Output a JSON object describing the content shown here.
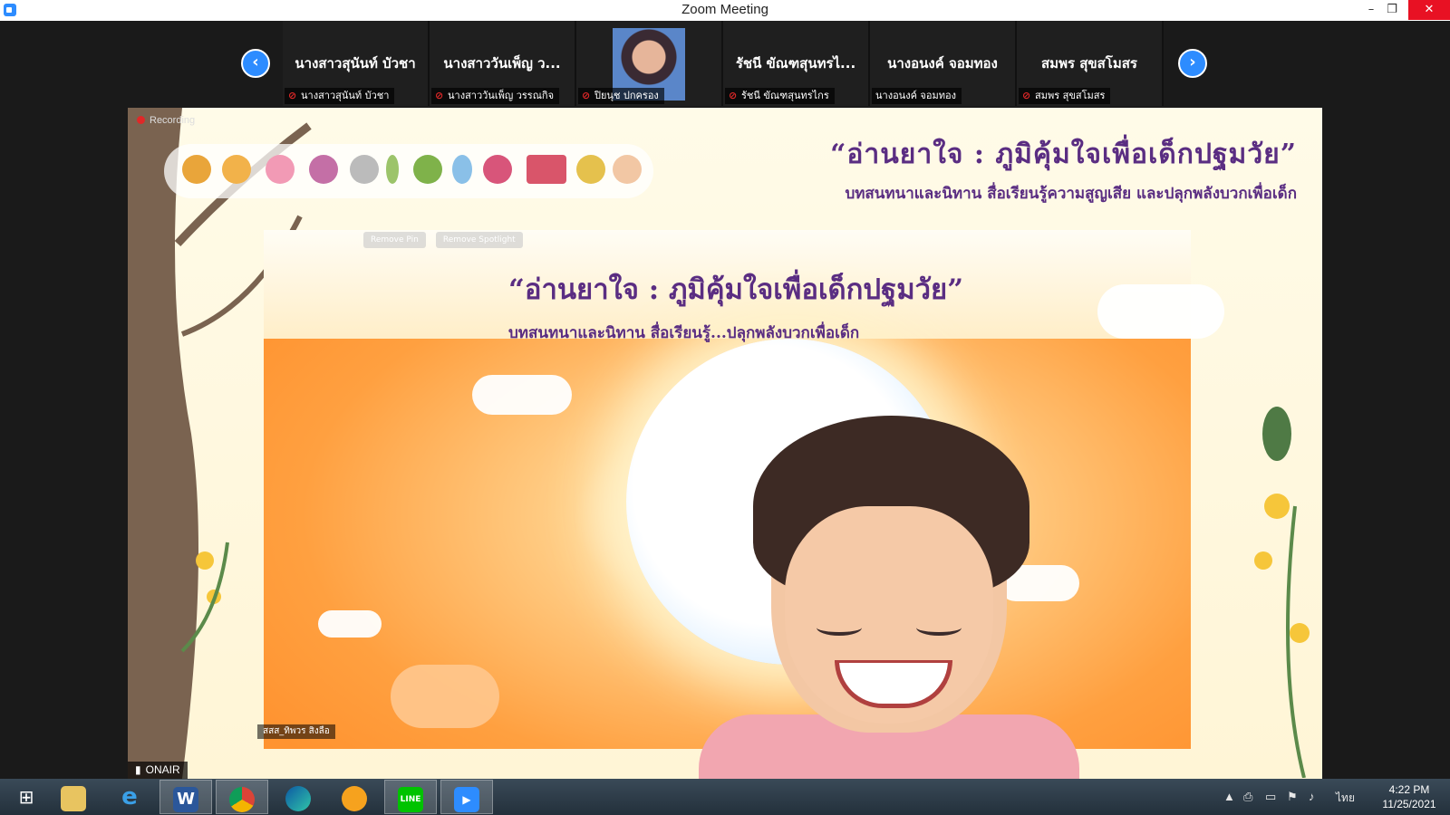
{
  "window": {
    "title": "Zoom Meeting",
    "minimize_label": "–",
    "maximize_label": "❐",
    "close_label": "✕"
  },
  "participants": {
    "prev_label": "‹",
    "next_label": "›",
    "tiles": [
      {
        "display_name": "นางสาวสุนันท์ บัวชา",
        "label": "นางสาวสุนันท์ บัวชา",
        "muted": true,
        "has_video": false
      },
      {
        "display_name": "นางสาววันเพ็ญ ว...",
        "label": "นางสาววันเพ็ญ วรรณกิจ",
        "muted": true,
        "has_video": false
      },
      {
        "display_name": "",
        "label": "ปิยนุช ปกครอง",
        "muted": true,
        "has_video": true
      },
      {
        "display_name": "รัชนี ขัณฑสุนทรไ...",
        "label": "รัชนี ขัณฑสุนทรไกร",
        "muted": true,
        "has_video": false
      },
      {
        "display_name": "นางอนงค์ จอมทอง",
        "label": "นางอนงค์ จอมทอง",
        "muted": false,
        "has_video": false
      },
      {
        "display_name": "สมพร สุขสโมสร",
        "label": "สมพร สุขสโมสร",
        "muted": true,
        "has_video": false
      }
    ]
  },
  "stage": {
    "recording_label": "Recording",
    "headline": "“อ่านยาใจ : ภูมิคุ้มใจเพื่อเด็กปฐมวัย”",
    "subheadline": "บทสนทนาและนิทาน สื่อเรียนรู้ความสูญเสีย และปลุกพลังบวกเพื่อเด็ก",
    "inner_headline": "“อ่านยาใจ : ภูมิคุ้มใจเพื่อเด็กปฐมวัย”",
    "inner_subheadline": "บทสนทนาและนิทาน สื่อเรียนรู้...ปลุกพลังบวกเพื่อเด็ก",
    "remove_pin": "Remove Pin",
    "remove_spotlight": "Remove Spotlight",
    "speaker_name": "สสส_ทิพวร สิงลือ",
    "onair_label": "ONAIR"
  },
  "taskbar": {
    "apps": [
      {
        "name": "start",
        "glyph": "⊞"
      },
      {
        "name": "file-explorer",
        "glyph": "📁"
      },
      {
        "name": "internet-explorer",
        "glyph": "e"
      },
      {
        "name": "word",
        "glyph": "W"
      },
      {
        "name": "chrome",
        "glyph": "◉"
      },
      {
        "name": "edge",
        "glyph": "◐"
      },
      {
        "name": "browser",
        "glyph": "◈"
      },
      {
        "name": "line",
        "glyph": "LINE"
      },
      {
        "name": "zoom",
        "glyph": "▶"
      }
    ],
    "language": "ไทย",
    "time": "4:22 PM",
    "date": "11/25/2021"
  },
  "colors": {
    "zoom_blue": "#2d8cff",
    "headline_purple": "#5a2d82",
    "close_red": "#e81123",
    "mute_red": "#e02828"
  }
}
